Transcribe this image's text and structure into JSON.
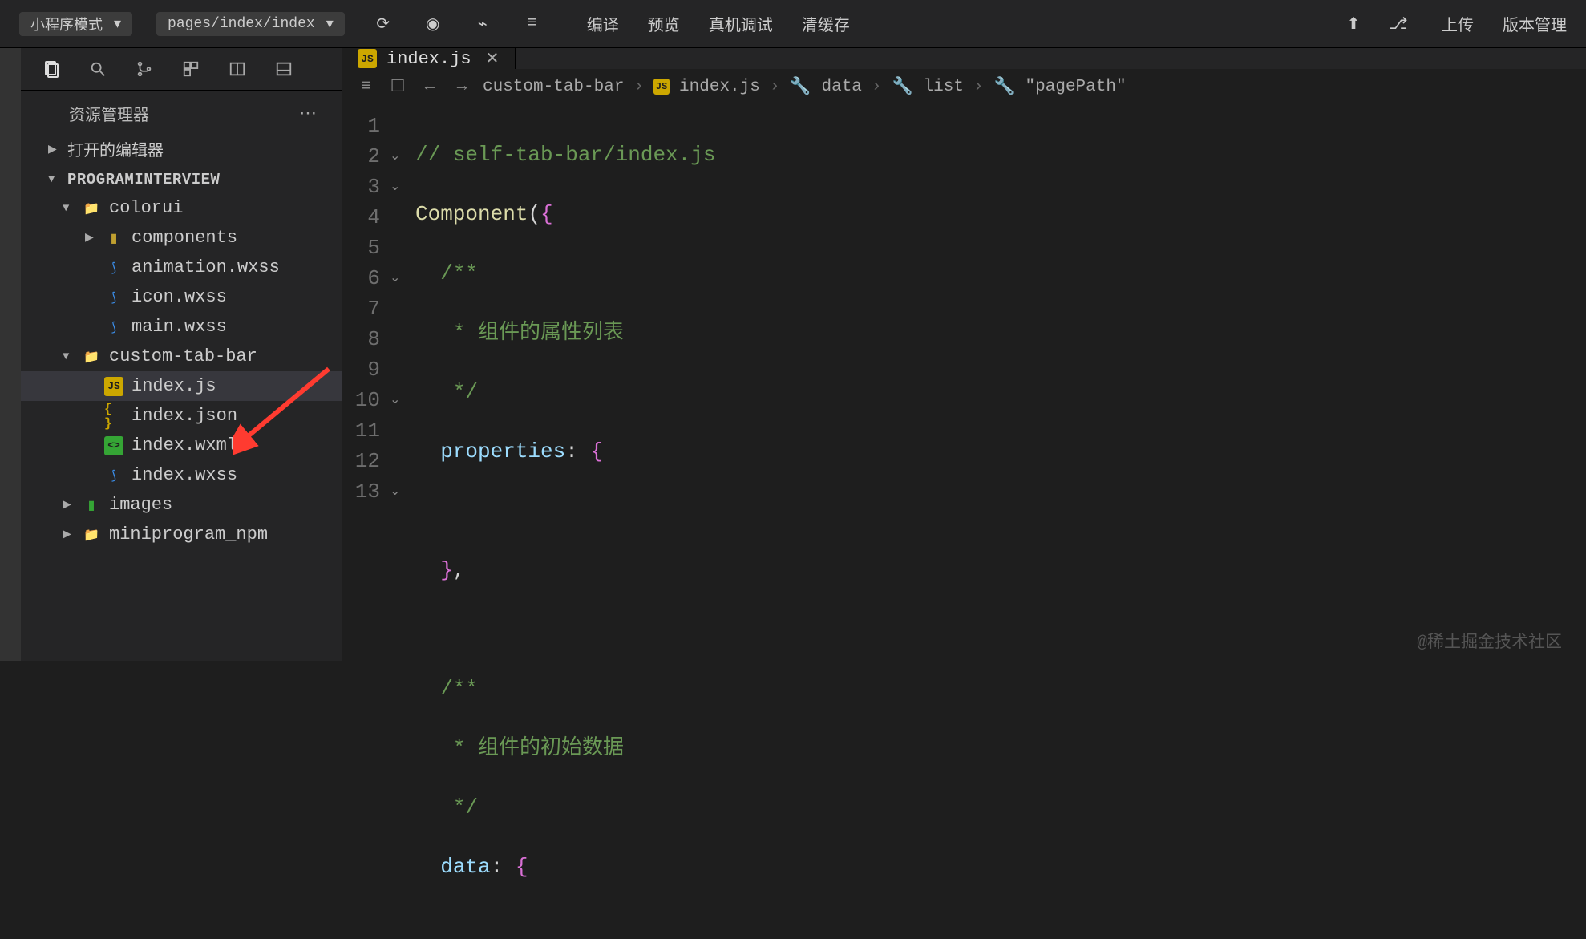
{
  "toolbar": {
    "mode": "小程序模式",
    "page": "pages/index/index",
    "center": [
      "编译",
      "预览",
      "真机调试",
      "清缓存"
    ],
    "right": [
      "上传",
      "版本管理"
    ]
  },
  "sidebar": {
    "title": "资源管理器",
    "sections": {
      "open_editors": "打开的编辑器",
      "project": "PROGRAMINTERVIEW"
    },
    "tree": {
      "colorui": {
        "label": "colorui",
        "items": [
          {
            "label": "components",
            "type": "folder"
          },
          {
            "label": "animation.wxss",
            "type": "wxss"
          },
          {
            "label": "icon.wxss",
            "type": "wxss"
          },
          {
            "label": "main.wxss",
            "type": "wxss"
          }
        ]
      },
      "custom_tab_bar": {
        "label": "custom-tab-bar",
        "items": [
          {
            "label": "index.js",
            "type": "js",
            "selected": true
          },
          {
            "label": "index.json",
            "type": "json"
          },
          {
            "label": "index.wxml",
            "type": "wxml"
          },
          {
            "label": "index.wxss",
            "type": "wxss"
          }
        ]
      },
      "images": {
        "label": "images"
      },
      "miniprogram_npm": {
        "label": "miniprogram_npm"
      }
    }
  },
  "tab": {
    "label": "index.js"
  },
  "breadcrumb": [
    "custom-tab-bar",
    "index.js",
    "data",
    "list",
    "\"pagePath\""
  ],
  "code": {
    "lines": [
      "// self-tab-bar/index.js",
      "Component({",
      "  /**",
      "   * 组件的属性列表",
      "   */",
      "  properties: {",
      "",
      "  },",
      "",
      "  /**",
      "   * 组件的初始数据",
      "   */",
      "  data: {"
    ]
  },
  "watermark": "@稀土掘金技术社区"
}
